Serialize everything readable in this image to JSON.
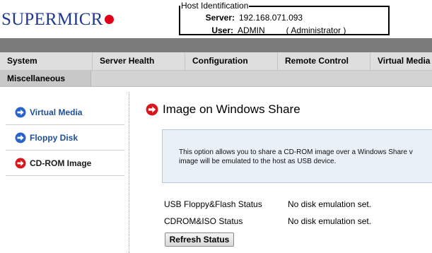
{
  "brand": {
    "logo_text": "SUPERMICR"
  },
  "host": {
    "title": "Host Identification",
    "server_label": "Server:",
    "server_value": "192.168.071.093",
    "user_label": "User:",
    "user_value": "ADMIN",
    "user_role": "( Administrator )"
  },
  "menu": {
    "items": [
      {
        "label": "System"
      },
      {
        "label": "Server Health"
      },
      {
        "label": "Configuration"
      },
      {
        "label": "Remote Control"
      },
      {
        "label": "Virtual Media"
      }
    ],
    "sub_items": [
      {
        "label": "Miscellaneous"
      }
    ]
  },
  "sidebar": {
    "items": [
      {
        "label": "Virtual Media",
        "icon": "arrow-right-circle-blue-icon"
      },
      {
        "label": "Floppy Disk",
        "icon": "arrow-right-circle-blue-icon"
      },
      {
        "label": "CD-ROM Image",
        "icon": "arrow-right-circle-red-icon",
        "active": true
      }
    ]
  },
  "main": {
    "title": "Image on Windows Share",
    "info_line1": "This option allows you to share a CD-ROM image over a Windows Share v",
    "info_line2": "image will be emulated to the host as USB device.",
    "status": [
      {
        "label": "USB Floppy&Flash Status",
        "value": "No disk emulation set."
      },
      {
        "label": "CDROM&ISO Status",
        "value": "No disk emulation set."
      }
    ],
    "refresh_label": "Refresh Status"
  },
  "colors": {
    "brand_blue": "#1f3a8f",
    "brand_red": "#e0001a",
    "link_blue": "#1f4e99",
    "icon_blue": "#2a64c8",
    "icon_red": "#d9161c"
  }
}
